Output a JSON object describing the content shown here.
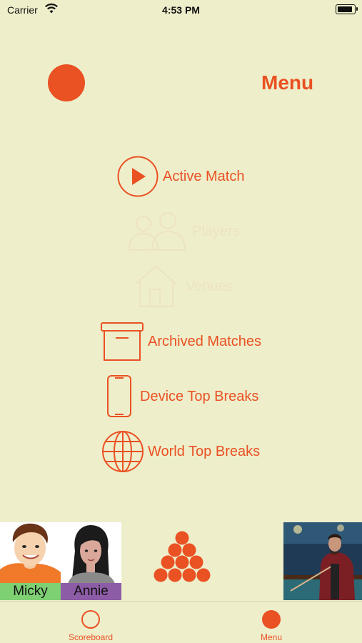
{
  "status_bar": {
    "carrier": "Carrier",
    "time": "4:53 PM",
    "battery_level": 0.9
  },
  "header": {
    "title": "Menu"
  },
  "menu": {
    "items": [
      {
        "label": "Active Match",
        "icon": "play-circle-icon",
        "enabled": true
      },
      {
        "label": "Players",
        "icon": "people-icon",
        "enabled": false
      },
      {
        "label": "Venues",
        "icon": "house-icon",
        "enabled": false
      },
      {
        "label": "Archived Matches",
        "icon": "archive-box-icon",
        "enabled": true
      },
      {
        "label": "Device Top Breaks",
        "icon": "phone-icon",
        "enabled": true
      },
      {
        "label": "World Top Breaks",
        "icon": "globe-icon",
        "enabled": true
      }
    ]
  },
  "players": [
    {
      "name": "Micky",
      "name_color": "#7fcf73"
    },
    {
      "name": "Annie",
      "name_color": "#8d5ca6"
    }
  ],
  "tabs": [
    {
      "label": "Scoreboard",
      "icon": "circle-outline-icon",
      "selected": false
    },
    {
      "label": "Menu",
      "icon": "circle-filled-icon",
      "selected": true
    }
  ],
  "colors": {
    "accent": "#ea5123",
    "background": "#eeeecb",
    "disabled": "#ede2c4"
  }
}
